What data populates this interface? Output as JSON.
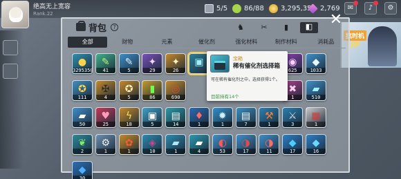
{
  "player": {
    "name": "绝高无上宽容",
    "rank": "Rank.22"
  },
  "resources": {
    "stamina": "5/5",
    "energy": "86/88",
    "gold": "3,295,350",
    "gems": "2,769"
  },
  "hud_icons": [
    "mail-icon",
    "bell-icon",
    "settings-icon"
  ],
  "banner": {
    "tag": "抗时机",
    "up": "UP"
  },
  "panel": {
    "title": "背包",
    "help": "?",
    "tools": [
      "♞",
      "✂",
      "▮",
      "◧"
    ],
    "close": "✕"
  },
  "tabs": [
    "全部",
    "财物",
    "元素",
    "催化剂",
    "强化材料",
    "制作材料",
    "消耗品"
  ],
  "active_tab": 0,
  "items": [
    {
      "glyph": "●",
      "count": "3295350",
      "bg": "#2f8fb0",
      "color": "#ffd34a"
    },
    {
      "glyph": "✎",
      "count": "41",
      "bg": "#3fb08d",
      "color": "#b6f27a"
    },
    {
      "glyph": "✎",
      "count": "5",
      "bg": "#3d8fc8",
      "color": "#d8f0ff"
    },
    {
      "glyph": "✦",
      "count": "29",
      "bg": "#7a4fb8",
      "color": "#f1d6ff"
    },
    {
      "glyph": "✦",
      "count": "26",
      "bg": "#c4892b",
      "color": "#fff2c0"
    },
    {
      "glyph": "▣",
      "count": "",
      "bg": "#2b7f9a",
      "color": "#9ff0ff"
    },
    {
      "glyph": "",
      "count": "",
      "bg": "transparent",
      "color": "#fff"
    },
    {
      "glyph": "",
      "count": "",
      "bg": "transparent",
      "color": "#fff"
    },
    {
      "glyph": "",
      "count": "",
      "bg": "transparent",
      "color": "#fff"
    },
    {
      "glyph": "◉",
      "count": "625",
      "bg": "#8a3fb0",
      "color": "#ffd0ff"
    },
    {
      "glyph": "◆",
      "count": "1033",
      "bg": "#3f8fc8",
      "color": "#e6f7ff"
    },
    {
      "glyph": "✪",
      "count": "111",
      "bg": "#3f8fc0",
      "color": "#ffd34a"
    },
    {
      "glyph": "✠",
      "count": "4",
      "bg": "#c48a2a",
      "color": "#2a2a2a"
    },
    {
      "glyph": "✪",
      "count": "5",
      "bg": "#c48a2a",
      "color": "#fff0b0"
    },
    {
      "glyph": "▮",
      "count": "86",
      "bg": "#c49a2a",
      "color": "#6cff4a"
    },
    {
      "glyph": "◎",
      "count": "690",
      "bg": "#c48a2a",
      "color": "#e04a2a"
    },
    {
      "glyph": "",
      "count": "",
      "bg": "transparent",
      "color": "#fff"
    },
    {
      "glyph": "",
      "count": "",
      "bg": "transparent",
      "color": "#fff"
    },
    {
      "glyph": "",
      "count": "",
      "bg": "transparent",
      "color": "#fff"
    },
    {
      "glyph": "",
      "count": "",
      "bg": "transparent",
      "color": "#fff"
    },
    {
      "glyph": "✖",
      "count": "1",
      "bg": "#b03f8f",
      "color": "#ffd0f0"
    },
    {
      "glyph": "▰",
      "count": "510",
      "bg": "#3f8fc8",
      "color": "#9ff0ff"
    },
    {
      "glyph": "▰",
      "count": "50",
      "bg": "#3f8fc8",
      "color": "#ffffff"
    },
    {
      "glyph": "♥",
      "count": "25",
      "bg": "#c43a5a",
      "color": "#ff9ab8"
    },
    {
      "glyph": "ϟ",
      "count": "18",
      "bg": "#c48a2a",
      "color": "#ffe24a"
    },
    {
      "glyph": "▣",
      "count": "5",
      "bg": "#3fa0c8",
      "color": "#ffffff"
    },
    {
      "glyph": "▤",
      "count": "14",
      "bg": "#2b9aa8",
      "color": "#ffffff"
    },
    {
      "glyph": "♦",
      "count": "1",
      "bg": "#2b6ab0",
      "color": "#ff6a6a"
    },
    {
      "glyph": "✹",
      "count": "1",
      "bg": "#2f8fc8",
      "color": "#cfefff"
    },
    {
      "glyph": "▤",
      "count": "7",
      "bg": "#3a8fc0",
      "color": "#ffffff"
    },
    {
      "glyph": "⚒",
      "count": "1",
      "bg": "#2b7fb0",
      "color": "#ff7a3a"
    },
    {
      "glyph": "⚔",
      "count": "3",
      "bg": "#2b7fb0",
      "color": "#d0dfe8"
    },
    {
      "glyph": "▦",
      "count": "1",
      "bg": "#c8c8c8",
      "color": "#d03a3a"
    },
    {
      "glyph": "❦",
      "count": "2",
      "bg": "#2b8a9a",
      "color": "#7af06a"
    },
    {
      "glyph": "⚙",
      "count": "1",
      "bg": "#6a8fb0",
      "color": "#f0f0f0"
    },
    {
      "glyph": "✿",
      "count": "1",
      "bg": "#c48a2a",
      "color": "#ff5a2a"
    },
    {
      "glyph": "◈",
      "count": "10",
      "bg": "#2b8ab0",
      "color": "#c04a8a"
    },
    {
      "glyph": "▰",
      "count": "1",
      "bg": "#2b8ab0",
      "color": "#b0e8f0"
    },
    {
      "glyph": "▰",
      "count": "4",
      "bg": "#2b9ab0",
      "color": "#ffffff"
    },
    {
      "glyph": "◐",
      "count": "53",
      "bg": "#3f8fc8",
      "color": "#ff5a5a"
    },
    {
      "glyph": "◑",
      "count": "17",
      "bg": "#3f8fc8",
      "color": "#e04a4a"
    },
    {
      "glyph": "◑",
      "count": "11",
      "bg": "#3f8fc8",
      "color": "#ff6a6a"
    },
    {
      "glyph": "◆",
      "count": "17",
      "bg": "#2b7fc8",
      "color": "#4ad0ff"
    },
    {
      "glyph": "◆",
      "count": "16",
      "bg": "#2b7fc8",
      "color": "#6ad8ff"
    },
    {
      "glyph": "◆",
      "count": "30",
      "bg": "#2b6fb8",
      "color": "#4ab0ff"
    }
  ],
  "detail": {
    "type": "宝箱",
    "name": "稀有催化剂选择箱",
    "desc": "可在稀有催化剂之中，选择获得1个。",
    "owned": "目前持有14个"
  }
}
